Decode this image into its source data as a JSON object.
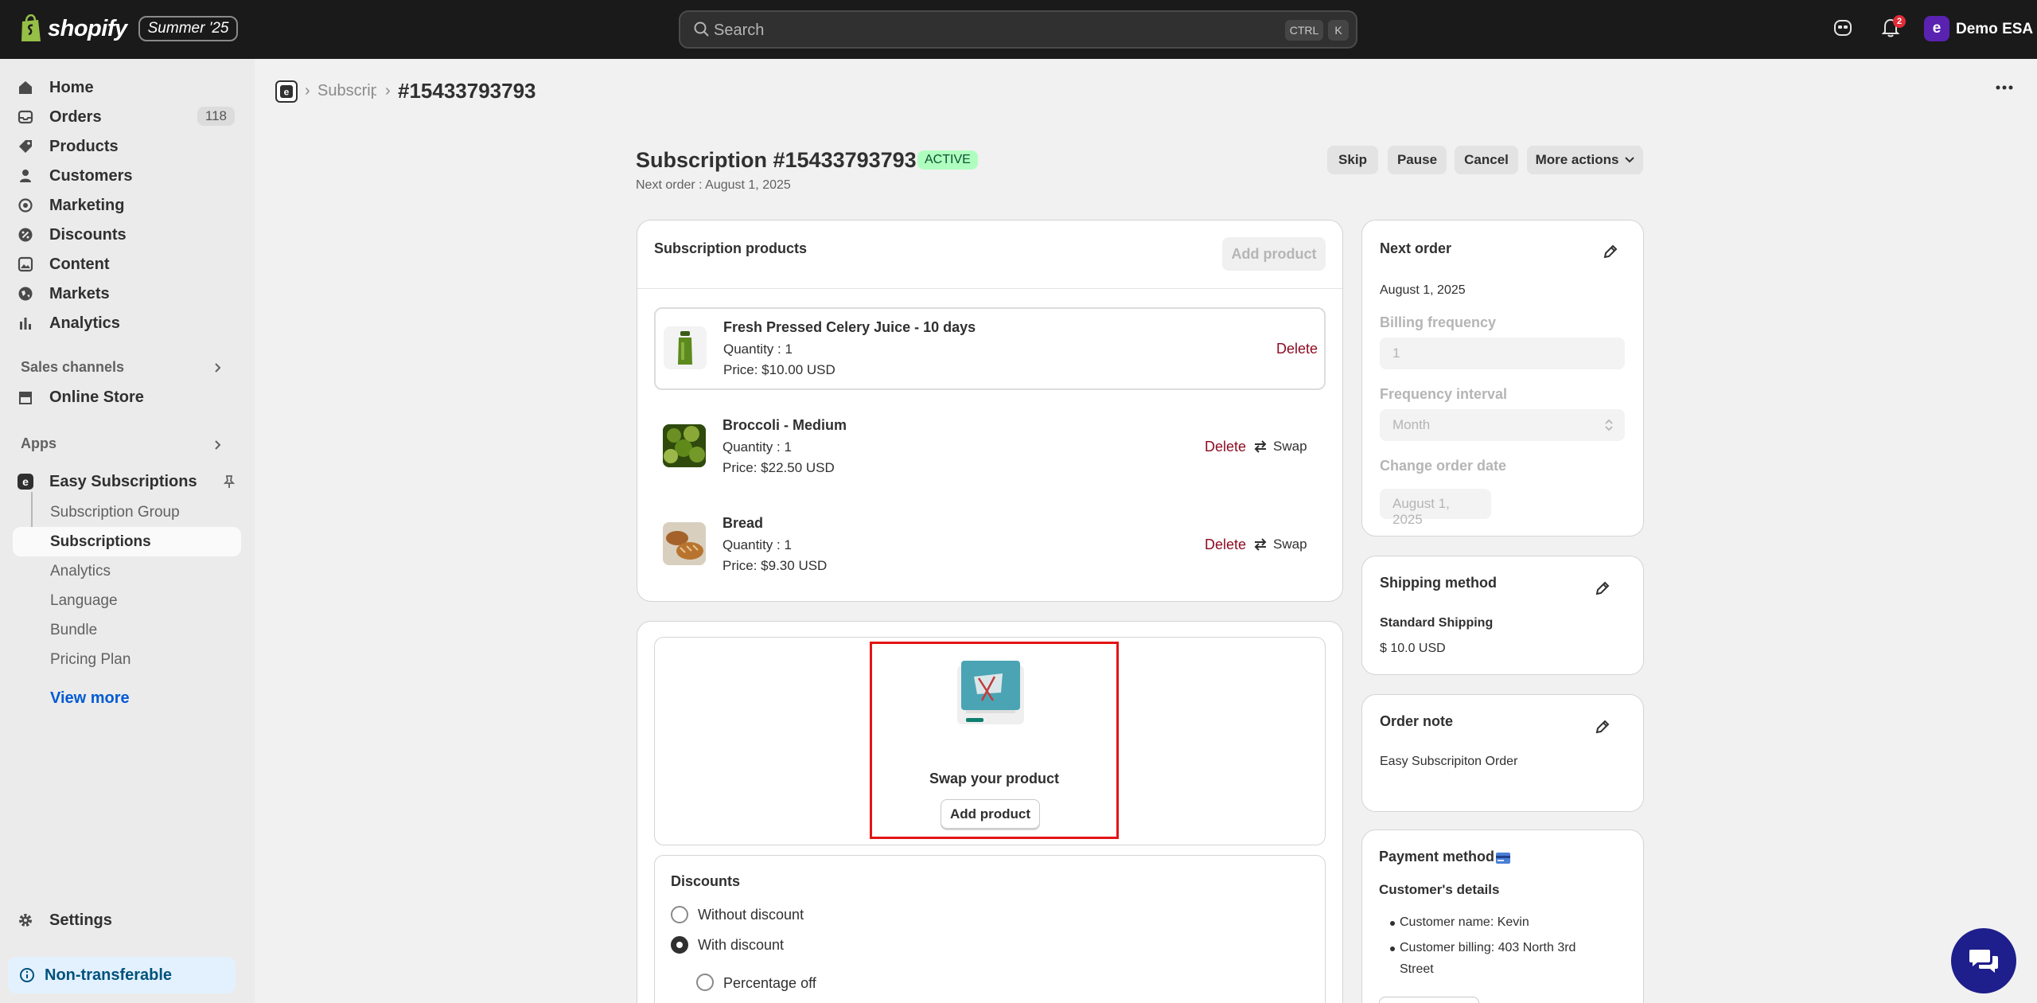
{
  "topbar": {
    "brand": "shopify",
    "edition": "Summer '25",
    "search_placeholder": "Search",
    "shortcut_ctrl": "CTRL",
    "shortcut_k": "K",
    "notification_count": "2",
    "store_initial": "e",
    "store_name": "Demo ESA"
  },
  "sidebar": {
    "items": [
      {
        "label": "Home"
      },
      {
        "label": "Orders",
        "count": "118"
      },
      {
        "label": "Products"
      },
      {
        "label": "Customers"
      },
      {
        "label": "Marketing"
      },
      {
        "label": "Discounts"
      },
      {
        "label": "Content"
      },
      {
        "label": "Markets"
      },
      {
        "label": "Analytics"
      }
    ],
    "sales_channels_label": "Sales channels",
    "online_store": "Online Store",
    "apps_label": "Apps",
    "app_name": "Easy Subscriptions",
    "app_subitems": [
      "Subscription Group",
      "Subscriptions",
      "Analytics",
      "Language",
      "Bundle",
      "Pricing Plan"
    ],
    "view_more": "View more",
    "settings": "Settings",
    "non_transferable": "Non-transferable"
  },
  "breadcrumb": {
    "parent": "Subscriptions",
    "current": "#15433793793"
  },
  "header": {
    "title": "Subscription #15433793793",
    "status": "ACTIVE",
    "next_order": "Next order : August 1, 2025",
    "skip": "Skip",
    "pause": "Pause",
    "cancel": "Cancel",
    "more_actions": "More actions"
  },
  "products_card": {
    "title": "Subscription products",
    "add_product": "Add product",
    "delete_label": "Delete",
    "swap_label": "Swap",
    "products": [
      {
        "name": "Fresh Pressed Celery Juice - 10 days",
        "quantity": "Quantity : 1",
        "price": "Price: $10.00 USD"
      },
      {
        "name": "Broccoli - Medium",
        "quantity": "Quantity : 1",
        "price": "Price: $22.50 USD"
      },
      {
        "name": "Bread",
        "quantity": "Quantity : 1",
        "price": "Price: $9.30 USD"
      }
    ]
  },
  "swap": {
    "title": "Swap your product",
    "button": "Add product"
  },
  "discounts": {
    "title": "Discounts",
    "options": [
      "Without discount",
      "With discount"
    ],
    "selected": "With discount",
    "sub_option": "Percentage off"
  },
  "next_order_card": {
    "title": "Next order",
    "date": "August 1, 2025",
    "billing_frequency_label": "Billing frequency",
    "billing_frequency_value": "1",
    "frequency_interval_label": "Frequency interval",
    "frequency_interval_value": "Month",
    "change_date_label": "Change order date",
    "change_date_value": "August 1, 2025"
  },
  "shipping_card": {
    "title": "Shipping method",
    "method": "Standard Shipping",
    "price": "$ 10.0 USD"
  },
  "note_card": {
    "title": "Order note",
    "note": "Easy Subscripiton Order"
  },
  "payment_card": {
    "title": "Payment method",
    "customer_details": "Customer's details",
    "customer_name": "Customer name: Kevin",
    "customer_billing_line1": "Customer billing: 403 North 3rd",
    "customer_billing_line2": "Street"
  },
  "colors": {
    "topbar": "#1a1a1a",
    "accent_link": "#005bd3",
    "delete": "#8e0b21",
    "active_badge": "#affebf",
    "highlight_box": "#e21515",
    "chat": "#1e1e8c"
  }
}
